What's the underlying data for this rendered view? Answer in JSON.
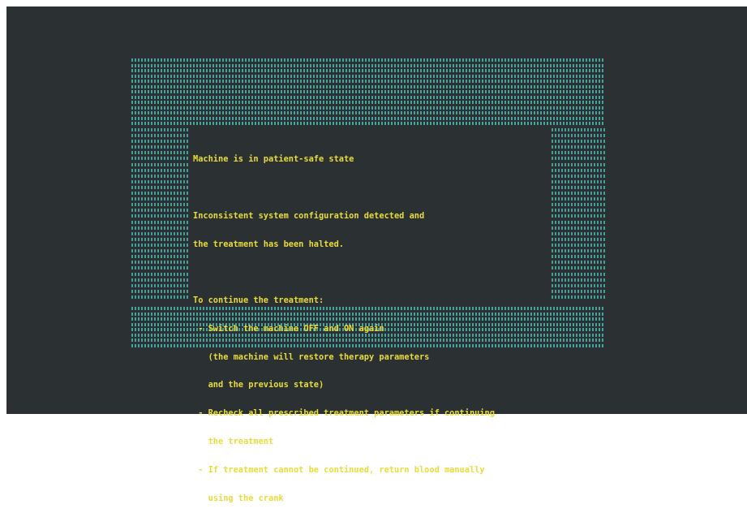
{
  "screen": {
    "colors": {
      "background": "#2b3132",
      "text": "#e8dc3a",
      "pattern": "#48aaa6"
    }
  },
  "message": {
    "title": "Machine is in patient-safe state",
    "description_lines": [
      "Inconsistent system configuration detected and",
      "the treatment has been halted."
    ],
    "instructions_heading": "To continue the treatment:",
    "instruction_lines": [
      " - Switch the machine OFF and ON again",
      "   (the machine will restore therapy parameters",
      "   and the previous state)",
      " - Recheck all prescribed treatment parameters if continuing",
      "   the treatment",
      " - If treatment cannot be continued, return blood manually",
      "   using the crank"
    ]
  }
}
